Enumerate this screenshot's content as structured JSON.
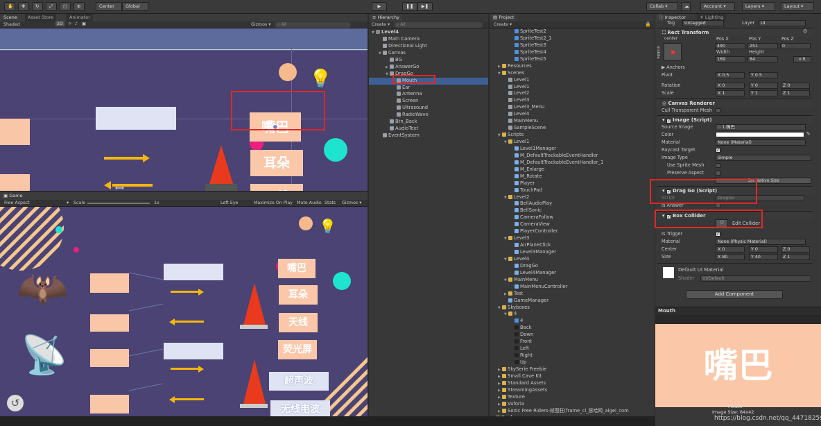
{
  "toolbar": {
    "center": "Center",
    "global": "Global",
    "collab": "Collab",
    "account": "Account",
    "layers": "Layers",
    "layout": "Layout"
  },
  "scene": {
    "tabs": [
      "Scene",
      "Asset Store",
      "Animator"
    ],
    "shaded": "Shaded",
    "mode2d": "2D",
    "gizmos": "Gizmos",
    "search": "All",
    "buttons": [
      "嘴巴",
      "耳朵",
      "天线"
    ]
  },
  "game": {
    "tab": "Game",
    "aspect": "Free Aspect",
    "scale_label": "Scale",
    "scale_value": "1x",
    "options": [
      "Left Eye",
      "Maximize On Play",
      "Mute Audio",
      "Stats",
      "Gizmos"
    ],
    "buttons": [
      "嘴巴",
      "耳朵",
      "天线",
      "荧光屏",
      "超声波",
      "无线电波"
    ]
  },
  "hierarchy": {
    "tab": "Hierarchy",
    "create": "Create",
    "search": "All",
    "items": [
      {
        "label": "Level4",
        "depth": 0,
        "arrow": "▼",
        "bold": true
      },
      {
        "label": "Main Camera",
        "depth": 1
      },
      {
        "label": "Directional Light",
        "depth": 1
      },
      {
        "label": "Canvas",
        "depth": 1,
        "arrow": "▼"
      },
      {
        "label": "BG",
        "depth": 2
      },
      {
        "label": "AnswerGo",
        "depth": 2,
        "arrow": "▶"
      },
      {
        "label": "DragGo",
        "depth": 2,
        "arrow": "▼"
      },
      {
        "label": "Mouth",
        "depth": 3,
        "selected": true
      },
      {
        "label": "Ear",
        "depth": 3
      },
      {
        "label": "Antenna",
        "depth": 3
      },
      {
        "label": "Screen",
        "depth": 3
      },
      {
        "label": "Ultrasound",
        "depth": 3
      },
      {
        "label": "RadioWave",
        "depth": 3
      },
      {
        "label": "Btn_Back",
        "depth": 2
      },
      {
        "label": "AudioText",
        "depth": 2
      },
      {
        "label": "EventSystem",
        "depth": 1
      }
    ]
  },
  "project": {
    "tab": "Project",
    "create": "Create",
    "items": [
      {
        "label": "SpriteTest2",
        "depth": 2,
        "kind": "sprite"
      },
      {
        "label": "SpriteTest2_1",
        "depth": 2,
        "kind": "sprite"
      },
      {
        "label": "SpriteTest3",
        "depth": 2,
        "kind": "sprite"
      },
      {
        "label": "SpriteTest4",
        "depth": 2,
        "kind": "sprite"
      },
      {
        "label": "SpriteTest5",
        "depth": 2,
        "kind": "sprite"
      },
      {
        "label": "Resources",
        "depth": 0,
        "arrow": "▶",
        "kind": "folder"
      },
      {
        "label": "Scenes",
        "depth": 0,
        "arrow": "▼",
        "kind": "folder"
      },
      {
        "label": "Level1",
        "depth": 1,
        "kind": "unity"
      },
      {
        "label": "Level1",
        "depth": 1,
        "kind": "unity"
      },
      {
        "label": "Level2",
        "depth": 1,
        "kind": "unity"
      },
      {
        "label": "Level3",
        "depth": 1,
        "kind": "unity"
      },
      {
        "label": "Level3_Menu",
        "depth": 1,
        "kind": "unity"
      },
      {
        "label": "Level4",
        "depth": 1,
        "kind": "unity"
      },
      {
        "label": "MainMenu",
        "depth": 1,
        "kind": "unity"
      },
      {
        "label": "SampleScene",
        "depth": 1,
        "kind": "unity"
      },
      {
        "label": "Scripts",
        "depth": 0,
        "arrow": "▼",
        "kind": "folder"
      },
      {
        "label": "Level1",
        "depth": 1,
        "arrow": "▼",
        "kind": "folder"
      },
      {
        "label": "Level1Manager",
        "depth": 2,
        "kind": "script"
      },
      {
        "label": "M_DefaultTrackableEventHandler",
        "depth": 2,
        "kind": "script"
      },
      {
        "label": "M_DefaultTrackableEventHandler_1",
        "depth": 2,
        "kind": "script"
      },
      {
        "label": "M_Enlarge",
        "depth": 2,
        "kind": "script"
      },
      {
        "label": "M_Rotate",
        "depth": 2,
        "kind": "script"
      },
      {
        "label": "Player",
        "depth": 2,
        "kind": "script"
      },
      {
        "label": "TouchPad",
        "depth": 2,
        "kind": "script"
      },
      {
        "label": "Level2",
        "depth": 1,
        "arrow": "▼",
        "kind": "folder"
      },
      {
        "label": "BellAudioPlay",
        "depth": 2,
        "kind": "script"
      },
      {
        "label": "BellSonic",
        "depth": 2,
        "kind": "script"
      },
      {
        "label": "CameraFollow",
        "depth": 2,
        "kind": "script"
      },
      {
        "label": "CameraView",
        "depth": 2,
        "kind": "script"
      },
      {
        "label": "PlayerController",
        "depth": 2,
        "kind": "script"
      },
      {
        "label": "Level3",
        "depth": 1,
        "arrow": "▼",
        "kind": "folder"
      },
      {
        "label": "AirPlaneClick",
        "depth": 2,
        "kind": "script"
      },
      {
        "label": "Level3Manager",
        "depth": 2,
        "kind": "script"
      },
      {
        "label": "Level4",
        "depth": 1,
        "arrow": "▼",
        "kind": "folder"
      },
      {
        "label": "DragGo",
        "depth": 2,
        "kind": "script"
      },
      {
        "label": "Level4Manager",
        "depth": 2,
        "kind": "script"
      },
      {
        "label": "MainMenu",
        "depth": 1,
        "arrow": "▼",
        "kind": "folder"
      },
      {
        "label": "MainMenuController",
        "depth": 2,
        "kind": "script"
      },
      {
        "label": "Test",
        "depth": 1,
        "arrow": "▶",
        "kind": "folder"
      },
      {
        "label": "GameManager",
        "depth": 1,
        "kind": "script"
      },
      {
        "label": "Skyboxes",
        "depth": 0,
        "arrow": "▼",
        "kind": "folder"
      },
      {
        "label": "4",
        "depth": 1,
        "arrow": "▼",
        "kind": "folder"
      },
      {
        "label": "4",
        "depth": 2,
        "kind": "sphere"
      },
      {
        "label": "Back",
        "depth": 2,
        "kind": "tex"
      },
      {
        "label": "Down",
        "depth": 2,
        "kind": "tex"
      },
      {
        "label": "Front",
        "depth": 2,
        "kind": "tex"
      },
      {
        "label": "Left",
        "depth": 2,
        "kind": "tex"
      },
      {
        "label": "Right",
        "depth": 2,
        "kind": "tex"
      },
      {
        "label": "Up",
        "depth": 2,
        "kind": "tex"
      },
      {
        "label": "SkySerie Freebie",
        "depth": 0,
        "arrow": "▶",
        "kind": "folder"
      },
      {
        "label": "Small Cave Kit",
        "depth": 0,
        "arrow": "▶",
        "kind": "folder"
      },
      {
        "label": "Standard Assets",
        "depth": 0,
        "arrow": "▶",
        "kind": "folder"
      },
      {
        "label": "StreamingAssets",
        "depth": 0,
        "arrow": "▶",
        "kind": "folder"
      },
      {
        "label": "Texture",
        "depth": 0,
        "arrow": "▶",
        "kind": "folder"
      },
      {
        "label": "Vuforia",
        "depth": 0,
        "arrow": "▶",
        "kind": "folder"
      },
      {
        "label": "Sonic Free Riders-帧图狂(frame_ci_愿哈网_aigei_com",
        "depth": 0,
        "arrow": "▶",
        "kind": "folder"
      },
      {
        "label": "Packages",
        "depth": -1,
        "arrow": "▶",
        "kind": "folder",
        "bold": true
      }
    ]
  },
  "inspector": {
    "tabs": [
      "Inspector",
      "Lighting"
    ],
    "tag_label": "Tag",
    "tag_value": "Untagged",
    "layer_label": "Layer",
    "layer_value": "UI",
    "rect": {
      "title": "Rect Transform",
      "anchor": "center",
      "middle": "middle",
      "posx_label": "Pos X",
      "posy_label": "Pos Y",
      "posz_label": "Pos Z",
      "posx": "490",
      "posy": "251",
      "posz": "0",
      "width_label": "Width",
      "height_label": "Height",
      "width": "169",
      "height": "84",
      "anchors": "Anchors",
      "pivot": "Pivot",
      "pivot_x": "0.5",
      "pivot_y": "0.5",
      "rotation": "Rotation",
      "rot_x": "0",
      "rot_y": "0",
      "rot_z": "0",
      "scale": "Scale",
      "sc_x": "1",
      "sc_y": "1",
      "sc_z": "1"
    },
    "canvas_renderer": {
      "title": "Canvas Renderer",
      "cull": "Cull Transparent Mesh"
    },
    "image": {
      "title": "Image (Script)",
      "source_label": "Source Image",
      "source": "1.嘴巴",
      "color": "Color",
      "material_label": "Material",
      "material": "None (Material)",
      "raycast": "Raycast Target",
      "type_label": "Image Type",
      "type": "Simple",
      "use_sprite": "Use Sprite Mesh",
      "preserve": "Preserve Aspect",
      "native": "Set Native Size"
    },
    "drag": {
      "title": "Drag Go (Script)",
      "script_label": "Script",
      "script": "DragGo",
      "is_answer": "Is Answer"
    },
    "box": {
      "title": "Box Collider",
      "edit": "Edit Collider",
      "trigger": "Is Trigger",
      "material_label": "Material",
      "material": "None (Physic Material)",
      "center": "Center",
      "cx": "0",
      "cy": "0",
      "cz": "0",
      "size": "Size",
      "sx": "80",
      "sy": "40",
      "sz": "1"
    },
    "default_mat": "Default UI Material",
    "shader_label": "Shader",
    "shader": "UI/Default",
    "add_component": "Add Component",
    "preview_title": "Mouth",
    "preview_text": "嘴巴",
    "preview_name": "Mouth",
    "image_size": "Image Size: 84x42"
  },
  "watermark": "https://blog.csdn.net/qq_44718259"
}
